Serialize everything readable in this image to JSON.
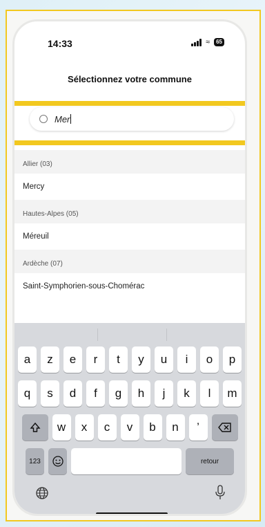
{
  "status_bar": {
    "time": "14:33",
    "battery": "65"
  },
  "page": {
    "title": "Sélectionnez votre commune"
  },
  "search": {
    "value": "Mer"
  },
  "results": [
    {
      "department": "Allier (03)",
      "commune": "Mercy"
    },
    {
      "department": "Hautes-Alpes (05)",
      "commune": "Méreuil"
    },
    {
      "department": "Ardèche (07)",
      "commune": "Saint-Symphorien-sous-Chomérac"
    }
  ],
  "keyboard": {
    "row1": [
      "a",
      "z",
      "e",
      "r",
      "t",
      "y",
      "u",
      "i",
      "o",
      "p"
    ],
    "row2": [
      "q",
      "s",
      "d",
      "f",
      "g",
      "h",
      "j",
      "k",
      "l",
      "m"
    ],
    "row3": [
      "w",
      "x",
      "c",
      "v",
      "b",
      "n",
      "’"
    ],
    "numbers_label": "123",
    "return_label": "retour",
    "accent_color": "#f2c81f"
  },
  "icons": [
    "clear-icon",
    "shift-icon",
    "delete-icon",
    "emoji-icon",
    "globe-icon",
    "mic-icon"
  ]
}
